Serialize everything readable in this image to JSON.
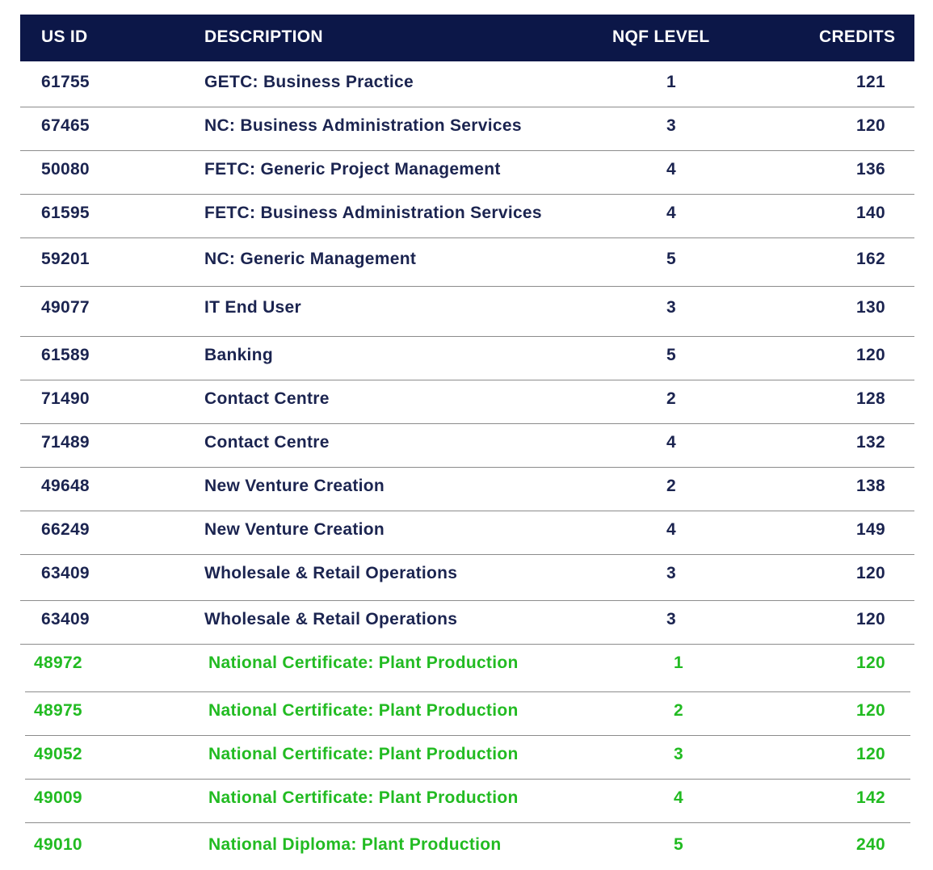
{
  "header": {
    "us_id": "US ID",
    "description": "DESCRIPTION",
    "nqf_level": "NQF LEVEL",
    "credits": "CREDITS"
  },
  "colors": {
    "header_bg": "#0c1748",
    "text": "#1b2450",
    "green": "#22bb22"
  },
  "rows": [
    {
      "id": "61755",
      "desc": "GETC: Business Practice",
      "nqf": "1",
      "credits": "121"
    },
    {
      "id": "67465",
      "desc": "NC: Business Administration Services",
      "nqf": "3",
      "credits": "120"
    },
    {
      "id": "50080",
      "desc": "FETC: Generic Project Management",
      "nqf": "4",
      "credits": "136"
    },
    {
      "id": "61595",
      "desc": "FETC: Business Administration Services",
      "nqf": "4",
      "credits": "140"
    },
    {
      "id": "59201",
      "desc": "NC: Generic Management",
      "nqf": "5",
      "credits": "162"
    },
    {
      "id": "49077",
      "desc": "IT End User",
      "nqf": "3",
      "credits": "130"
    },
    {
      "id": "61589",
      "desc": "Banking",
      "nqf": "5",
      "credits": "120"
    },
    {
      "id": "71490",
      "desc": "Contact Centre",
      "nqf": "2",
      "credits": "128"
    },
    {
      "id": "71489",
      "desc": "Contact Centre",
      "nqf": "4",
      "credits": "132"
    },
    {
      "id": "49648",
      "desc": "New Venture Creation",
      "nqf": "2",
      "credits": "138"
    },
    {
      "id": "66249",
      "desc": "New Venture Creation",
      "nqf": "4",
      "credits": "149"
    },
    {
      "id": "63409",
      "desc": "Wholesale & Retail Operations",
      "nqf": "3",
      "credits": "120"
    },
    {
      "id": "63409",
      "desc": "Wholesale & Retail Operations",
      "nqf": "3",
      "credits": "120"
    },
    {
      "id": "48972",
      "desc": "National Certificate: Plant Production",
      "nqf": "1",
      "credits": "120"
    },
    {
      "id": "48975",
      "desc": "National Certificate: Plant Production",
      "nqf": "2",
      "credits": "120"
    },
    {
      "id": "49052",
      "desc": "National Certificate: Plant Production",
      "nqf": "3",
      "credits": "120"
    },
    {
      "id": "49009",
      "desc": "National Certificate: Plant Production",
      "nqf": "4",
      "credits": "142"
    },
    {
      "id": "49010",
      "desc": "National Diploma: Plant Production",
      "nqf": "5",
      "credits": "240"
    }
  ]
}
